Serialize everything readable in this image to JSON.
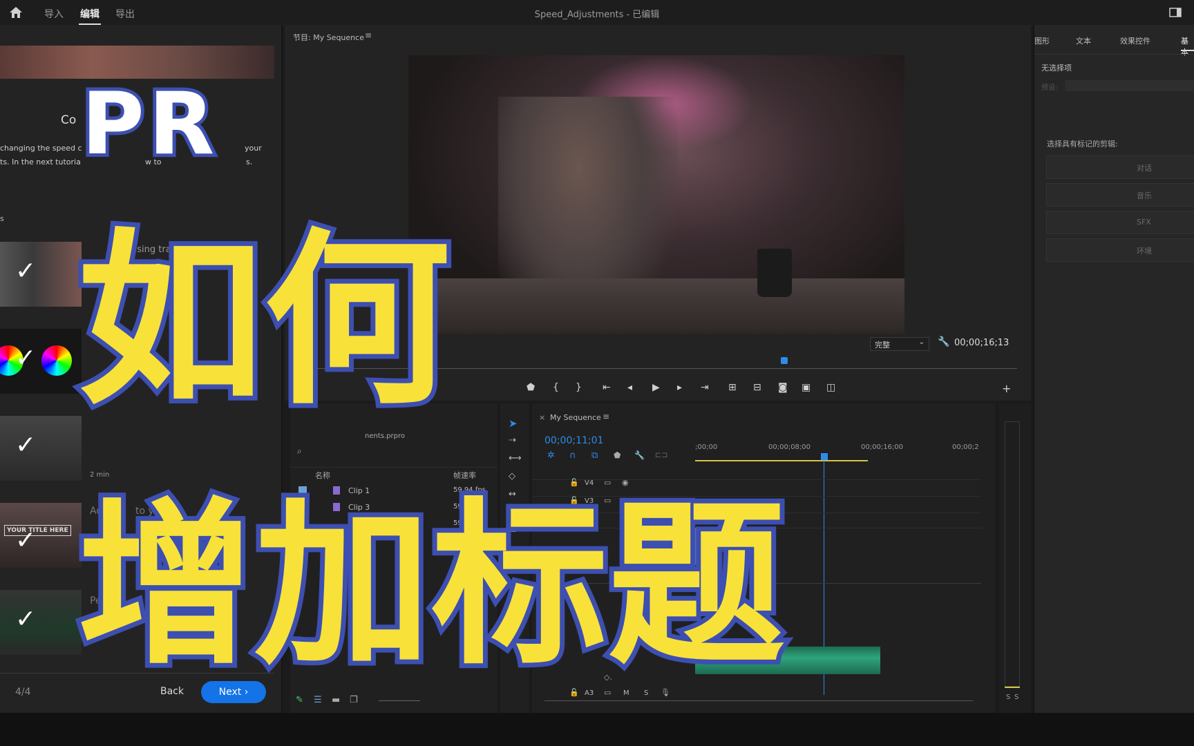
{
  "app": {
    "window_title": "Speed_Adjustments - 已编辑",
    "workspace_tabs": [
      "导入",
      "编辑",
      "导出"
    ],
    "active_tab": "编辑",
    "accent_color": "#1473e6"
  },
  "left_panel": {
    "heading_partial": "Co",
    "body_line1_a": "changing the speed c",
    "body_line1_b": "your",
    "body_line2_a": "ts. In the next tutoria",
    "body_line2_b": "w to",
    "body_line2_c": "s.",
    "section_letter": "s",
    "items": [
      {
        "label": "using transition",
        "duration": "",
        "done": true
      },
      {
        "label": "",
        "duration": "3",
        "done": true
      },
      {
        "label": "",
        "duration": "2 min",
        "done": true
      },
      {
        "label": "Add",
        "label_b": "to your",
        "thumb_text": "YOUR TITLE HERE",
        "done": true
      },
      {
        "label": "Per",
        "done": true
      }
    ],
    "progress": "4/4",
    "back_label": "Back",
    "next_label": "Next"
  },
  "program_monitor": {
    "title": "节目: My Sequence",
    "quality": "完整",
    "timecode": "00;00;16;13"
  },
  "project_panel": {
    "filename_partial": "nents.prpro",
    "col_name": "名称",
    "col_fps": "帧速率",
    "clips": [
      {
        "name": "Clip 1",
        "fps": "59.94 fps"
      },
      {
        "name": "Clip 3",
        "fps": "59.94 fps"
      },
      {
        "name": "2",
        "fps": "59.94 fps"
      }
    ]
  },
  "timeline": {
    "sequence_name": "My Sequence",
    "timecode": "00;00;11;01",
    "ruler": [
      ";00;00",
      "00;00;08;00",
      "00;00;16;00",
      "00;00;2"
    ],
    "tracks": [
      "V4",
      "V3",
      "V2",
      "A3"
    ],
    "audio_buttons": [
      "M",
      "S"
    ],
    "meter_labels": [
      "S",
      "S"
    ]
  },
  "right_panel": {
    "tabs": [
      "图形",
      "文本",
      "效果控件",
      "基本"
    ],
    "no_selection": "无选择项",
    "preset_label": "预设:",
    "select_prompt": "选择具有标记的剪辑:",
    "buttons": [
      "对话",
      "音乐",
      "SFX",
      "环境"
    ]
  },
  "overlay": {
    "line1": "PR",
    "line2": "如何",
    "line3": "增加标题"
  }
}
